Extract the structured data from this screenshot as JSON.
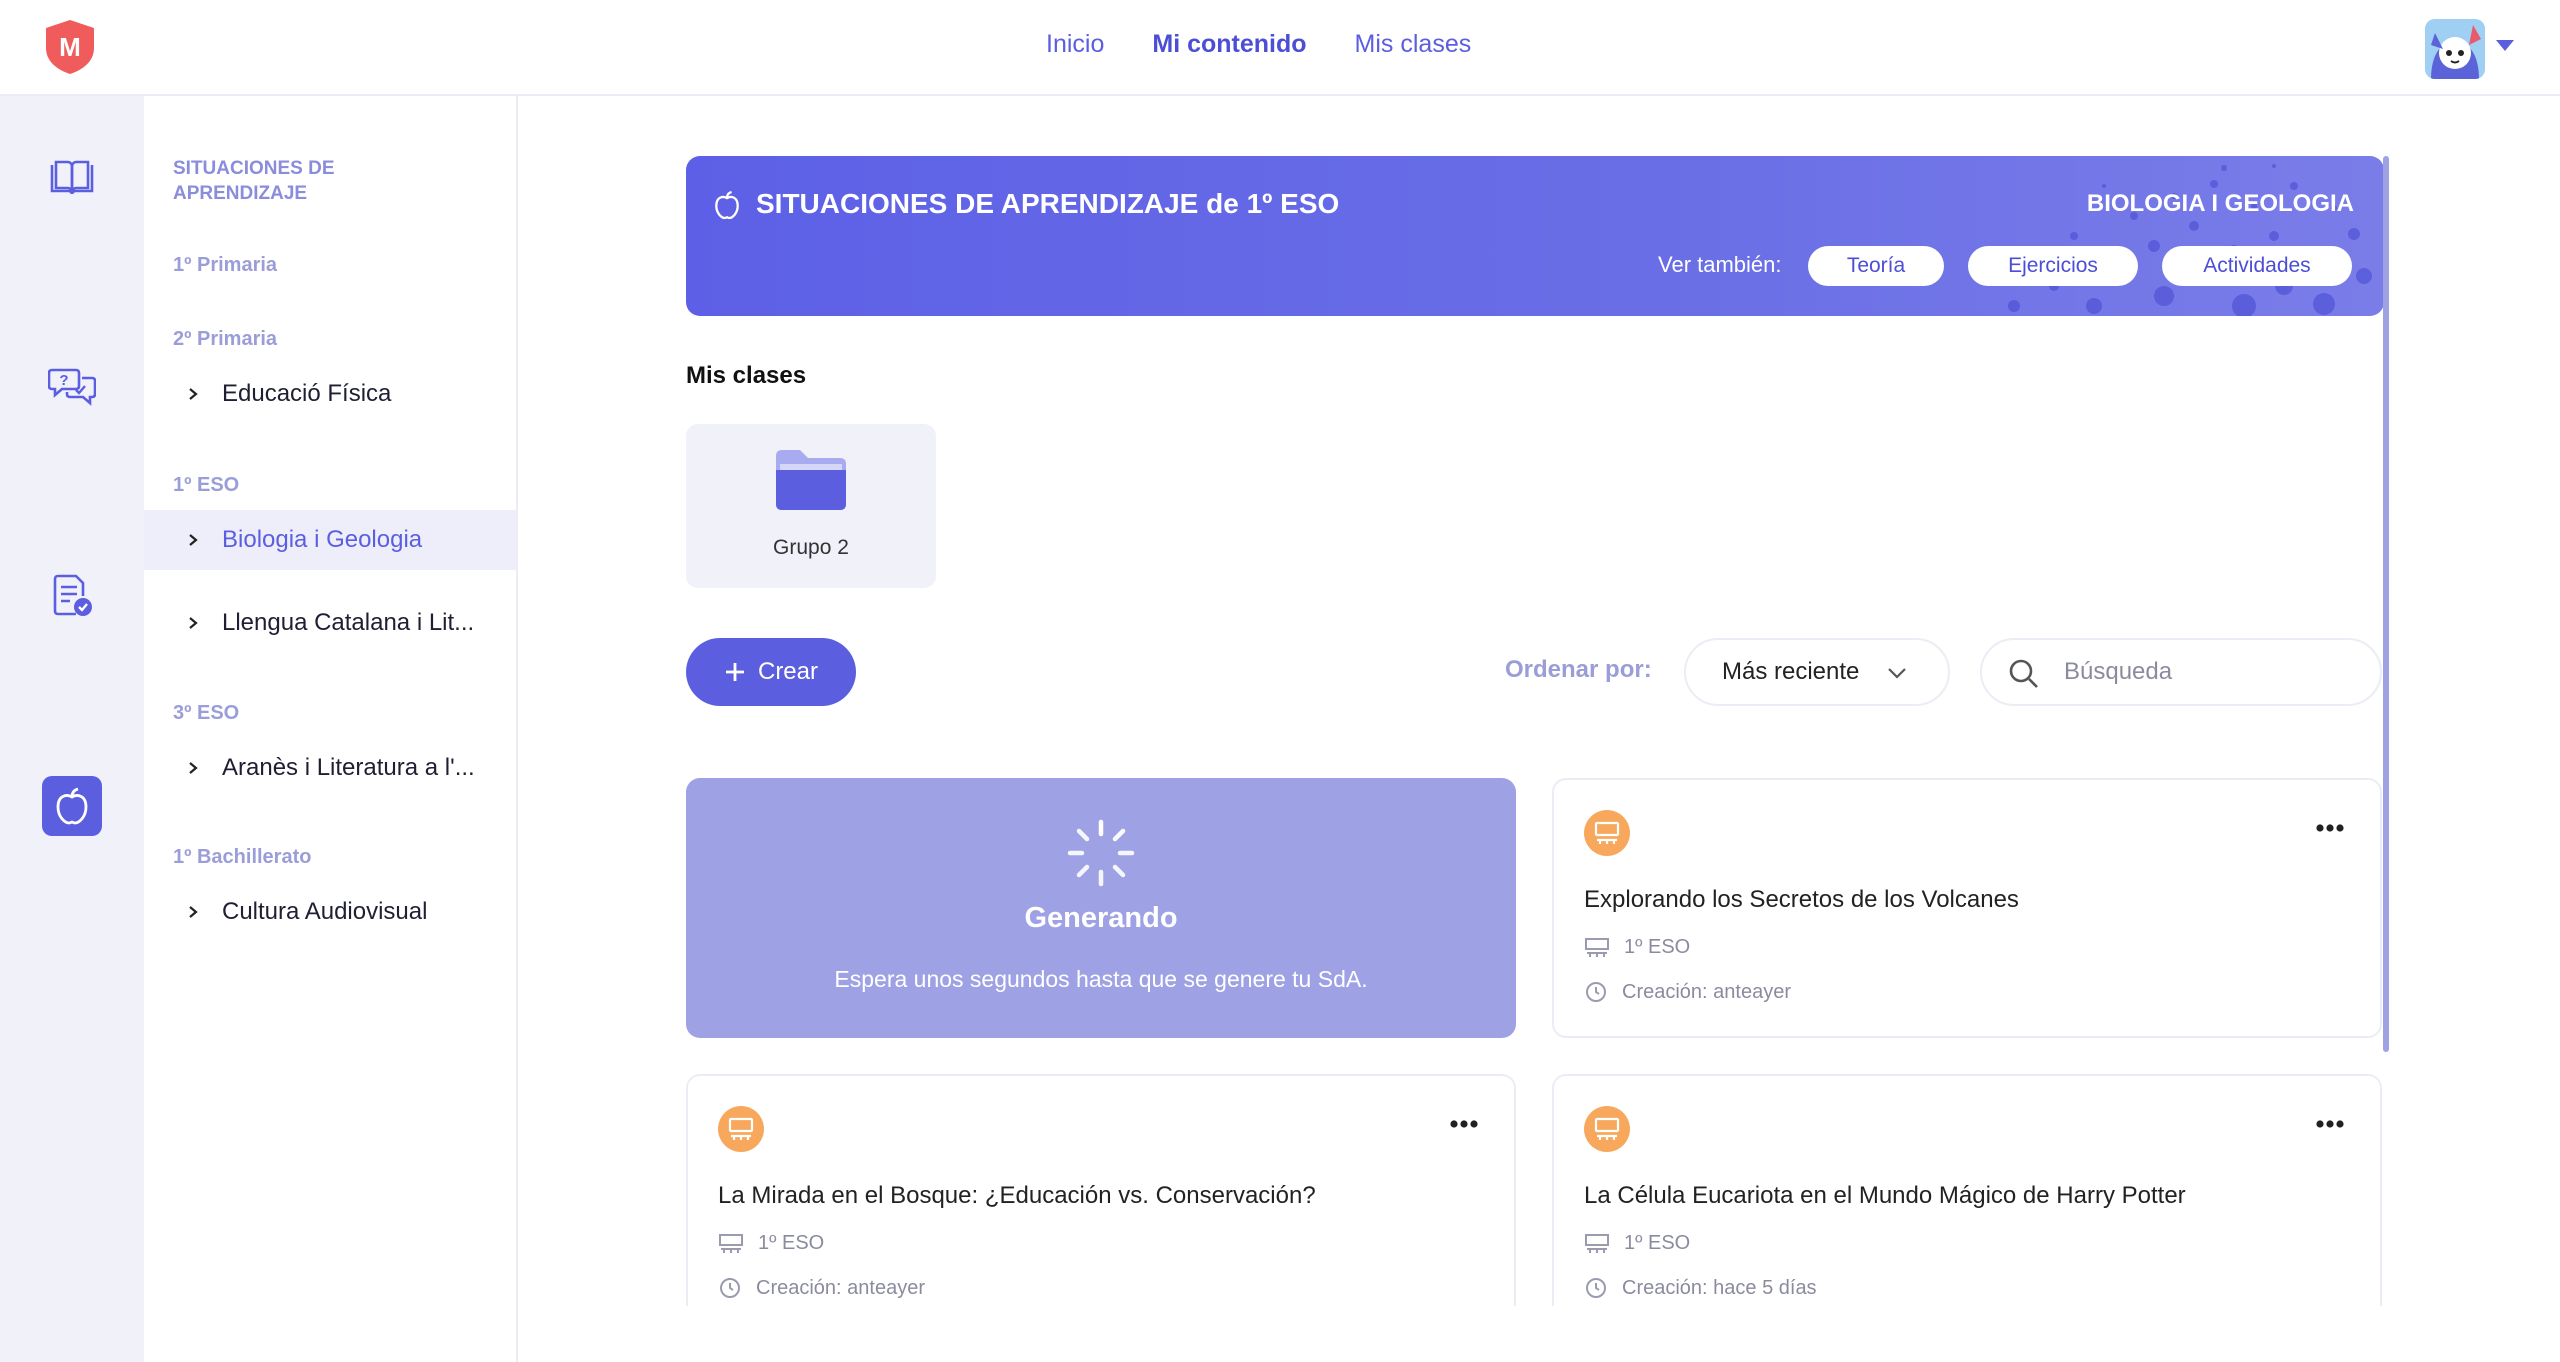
{
  "topbar": {
    "logo_letter": "M",
    "nav": [
      {
        "label": "Inicio",
        "active": false
      },
      {
        "label": "Mi contenido",
        "active": true
      },
      {
        "label": "Mis clases",
        "active": false
      }
    ]
  },
  "rail": {
    "icons": [
      "book-icon",
      "chat-question-icon",
      "checklist-icon",
      "apple-icon"
    ],
    "active": "apple-icon"
  },
  "sidebar": {
    "title": "SITUACIONES DE APRENDIZAJE",
    "levels": [
      {
        "label": "1º Primaria",
        "items": []
      },
      {
        "label": "2º Primaria",
        "items": [
          {
            "label": "Educació Física",
            "active": false
          }
        ]
      },
      {
        "label": "1º ESO",
        "items": [
          {
            "label": "Biologia i Geologia",
            "active": true
          },
          {
            "label": "Llengua Catalana i Lit...",
            "active": false
          }
        ]
      },
      {
        "label": "3º ESO",
        "items": [
          {
            "label": "Aranès i Literatura a l'...",
            "active": false
          }
        ]
      },
      {
        "label": "1º Bachillerato",
        "items": [
          {
            "label": "Cultura Audiovisual",
            "active": false
          }
        ]
      }
    ]
  },
  "banner": {
    "title": "SITUACIONES DE APRENDIZAJE de 1º ESO",
    "subject": "BIOLOGIA I GEOLOGIA",
    "see_also_label": "Ver también:",
    "links": [
      "Teoría",
      "Ejercicios",
      "Actividades"
    ]
  },
  "classes": {
    "title": "Mis clases",
    "items": [
      {
        "label": "Grupo 2"
      }
    ]
  },
  "toolbar": {
    "create_label": "Crear",
    "order_label": "Ordenar por:",
    "order_value": "Más reciente",
    "search_placeholder": "Búsqueda"
  },
  "generating": {
    "title": "Generando",
    "subtitle": "Espera unos segundos hasta que se genere tu SdA."
  },
  "cards": [
    {
      "title": "Explorando los Secretos de los Volcanes",
      "level": "1º ESO",
      "created": "Creación: anteayer"
    },
    {
      "title": "La Mirada en el Bosque: ¿Educación vs. Conservación?",
      "level": "1º ESO",
      "created": "Creación: anteayer"
    },
    {
      "title": "La Célula Eucariota en el Mundo Mágico de Harry Potter",
      "level": "1º ESO",
      "created": "Creación: hace 5 días"
    }
  ],
  "colors": {
    "accent": "#5c5ee0",
    "badge": "#f7a85d",
    "generating_bg": "#9ea2e4",
    "rail_bg": "#f1f1fa"
  }
}
